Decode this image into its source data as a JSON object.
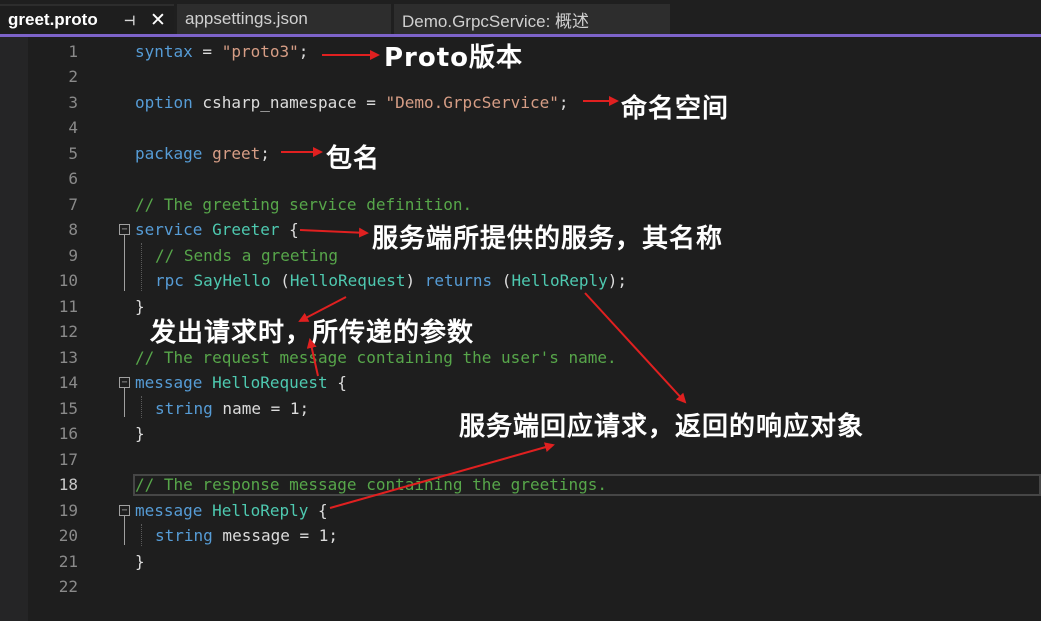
{
  "tabs": [
    {
      "label": "greet.proto",
      "active": true,
      "pin_icon": "pin-icon",
      "close_icon": "close-icon"
    },
    {
      "label": "appsettings.json",
      "active": false
    },
    {
      "label": "Demo.GrpcService: 概述",
      "active": false
    }
  ],
  "line_numbers": [
    "1",
    "2",
    "3",
    "4",
    "5",
    "6",
    "7",
    "8",
    "9",
    "10",
    "11",
    "12",
    "13",
    "14",
    "15",
    "16",
    "17",
    "18",
    "19",
    "20",
    "21",
    "22"
  ],
  "current_line": "18",
  "code": {
    "l1": {
      "kw": "syntax",
      "op": " = ",
      "str": "\"proto3\"",
      "end": ";"
    },
    "l3": {
      "kw": "option",
      "name": " csharp_namespace = ",
      "str": "\"Demo.GrpcService\"",
      "end": ";"
    },
    "l5": {
      "kw": "package",
      "pkg": " greet",
      "end": ";"
    },
    "l7": {
      "comment": "// The greeting service definition."
    },
    "l8": {
      "kw": "service",
      "type": " Greeter",
      "end": " {"
    },
    "l9": {
      "comment": "// Sends a greeting"
    },
    "l10": {
      "kw": "rpc",
      "method": " SayHello",
      "p1": " (",
      "req": "HelloRequest",
      "p2": ") ",
      "kw2": "returns",
      "p3": " (",
      "rep": "HelloReply",
      "p4": ");"
    },
    "l11": {
      "text": "}"
    },
    "l13": {
      "comment": "// The request message containing the user's name."
    },
    "l14": {
      "kw": "message",
      "type": " HelloRequest",
      "end": " {"
    },
    "l15": {
      "kw": "string",
      "field": " name = ",
      "num": "1",
      "end": ";"
    },
    "l16": {
      "text": "}"
    },
    "l18": {
      "comment": "// The response message containing the greetings."
    },
    "l19": {
      "kw": "message",
      "type": " HelloReply",
      "end": " {"
    },
    "l20": {
      "kw": "string",
      "field": " message = ",
      "num": "1",
      "end": ";"
    },
    "l21": {
      "text": "}"
    }
  },
  "annotations": {
    "version": "Proto版本",
    "namespace": "命名空间",
    "package": "包名",
    "service": "服务端所提供的服务，其名称",
    "request": "发出请求时，所传递的参数",
    "response": "服务端回应请求，返回的响应对象"
  },
  "colors": {
    "keyword": "#569cd6",
    "type": "#4ec9b0",
    "string": "#d69d85",
    "comment": "#57a64a",
    "arrow": "#e02020",
    "accent": "#7d63c9"
  }
}
